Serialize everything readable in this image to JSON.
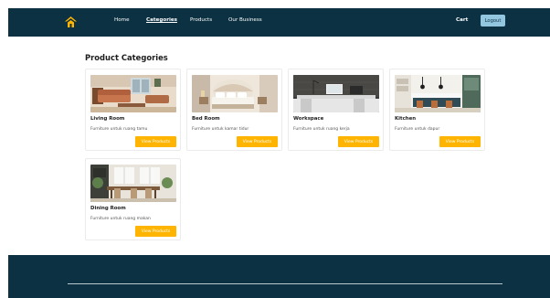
{
  "nav": {
    "links": [
      "Home",
      "Categories",
      "Products",
      "Our Business"
    ],
    "active": "Categories",
    "cart": "Cart",
    "logout": "Logout"
  },
  "main": {
    "title": "Product Categories",
    "categories": [
      {
        "name": "Living Room",
        "description": "Furniture untuk ruang tamu",
        "button": "View Products"
      },
      {
        "name": "Bed Room",
        "description": "Furniture untuk kamar tidur",
        "button": "View Products"
      },
      {
        "name": "Workspace",
        "description": "Furniture untuk ruang kerja",
        "button": "View Products"
      },
      {
        "name": "Kitchen",
        "description": "Furniture untuk dapur",
        "button": "View Products"
      },
      {
        "name": "Dining Room",
        "description": "Furniture untuk ruang makan",
        "button": "View Products"
      }
    ]
  },
  "colors": {
    "navy": "#0b3142",
    "accent": "#ffb400",
    "logout_bg": "#93c7e0"
  },
  "icons": {
    "logo": "house-logo-icon"
  }
}
